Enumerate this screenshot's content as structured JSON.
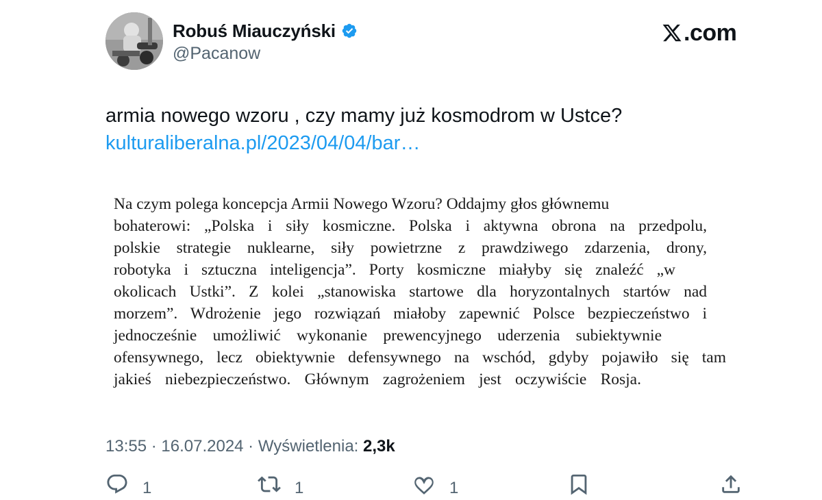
{
  "author": {
    "name": "Robuś Miauczyński",
    "handle": "@Pacanow",
    "verified": true,
    "avatar_icon": "avatar-photo"
  },
  "brand": {
    "logo_icon": "x-logo-icon",
    "text": ".com"
  },
  "tweet": {
    "text": "armia nowego wzoru , czy mamy już kosmodrom w Ustce?",
    "link": "kulturaliberalna.pl/2023/04/04/bar…"
  },
  "quote_image": {
    "lines": [
      "Na czym polega koncepcja Armii Nowego Wzoru? Oddajmy głos głównemu",
      "bohaterowi: „Polska i siły kosmiczne. Polska i aktywna obrona na przedpolu,",
      "polskie strategie nuklearne, siły powietrzne z prawdziwego zdarzenia, drony,",
      "robotyka i sztuczna inteligencja”. Porty kosmiczne miałyby się znaleźć „w",
      "okolicach Ustki”. Z kolei „stanowiska startowe dla horyzontalnych startów nad",
      "morzem”. Wdrożenie jego rozwiązań miałoby zapewnić Polsce bezpieczeństwo i",
      "jednocześnie umożliwić wykonanie prewencyjnego uderzenia subiektywnie",
      "ofensywnego, lecz obiektywnie defensywnego na wschód, gdyby pojawiło się tam",
      "jakieś niebezpieczeństwo. Głównym zagrożeniem jest oczywiście Rosja."
    ]
  },
  "meta": {
    "time": "13:55",
    "separator": " · ",
    "date": "16.07.2024",
    "views_label": "Wyświetlenia: ",
    "views_count": "2,3k"
  },
  "actions": {
    "reply": {
      "icon": "reply-icon",
      "count": "1"
    },
    "retweet": {
      "icon": "retweet-icon",
      "count": "1"
    },
    "like": {
      "icon": "heart-icon",
      "count": "1"
    },
    "bookmark": {
      "icon": "bookmark-icon"
    },
    "share": {
      "icon": "share-icon"
    }
  },
  "colors": {
    "link": "#1d9bf0",
    "secondary_text": "#536471",
    "primary_text": "#0f1419",
    "verified_badge": "#1d9bf0"
  }
}
